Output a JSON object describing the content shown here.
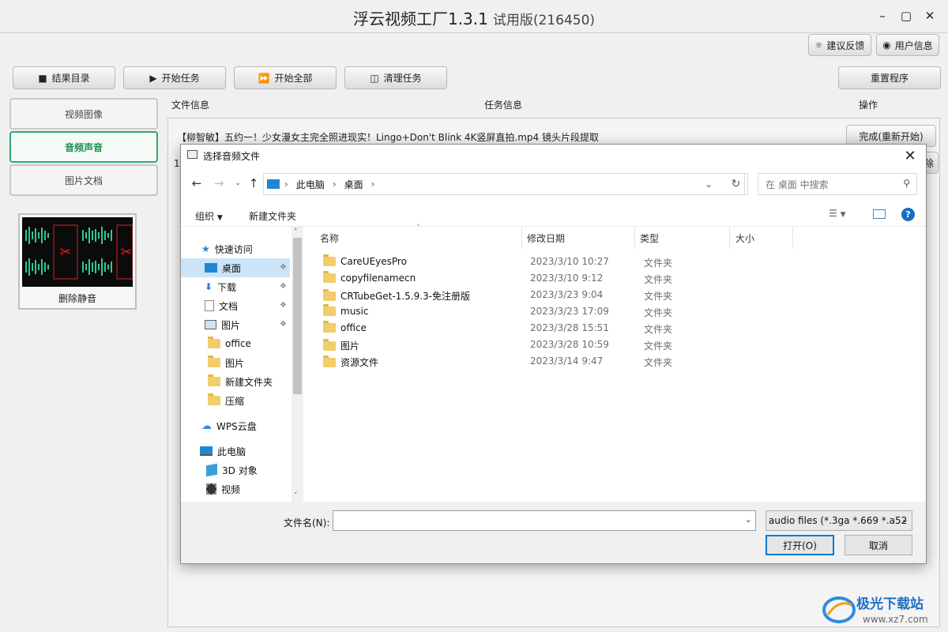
{
  "app": {
    "title": "浮云视频工厂1.3.1",
    "edition": "试用版(216450)",
    "feedback_label": "建议反馈",
    "userinfo_label": "用户信息"
  },
  "toolbar": {
    "result_dir": "结果目录",
    "start_task": "开始任务",
    "start_all": "开始全部",
    "clear_tasks": "清理任务",
    "reset_program": "重置程序"
  },
  "sidebar": {
    "items": [
      {
        "label": "视频图像"
      },
      {
        "label": "音频声音"
      },
      {
        "label": "图片文档"
      }
    ],
    "card_label": "删除静音"
  },
  "task_table": {
    "headers": [
      "文件信息",
      "任务信息",
      "操作"
    ],
    "row_filename": "【柳智敏】五约一！少女漫女主完全照进现实！Lingo+Don't Blink 4K竖屏直拍.mp4 镜头片段提取",
    "row_index": "1",
    "row_action": "完成(重新开始)",
    "row_action2": "除"
  },
  "dialog": {
    "title": "选择音频文件",
    "breadcrumb": [
      "此电脑",
      "桌面"
    ],
    "search_placeholder": "在 桌面 中搜索",
    "organize": "组织",
    "new_folder": "新建文件夹",
    "nav": [
      {
        "label": "快速访问",
        "icon": "star-icon"
      },
      {
        "label": "桌面",
        "icon": "desktop-icon",
        "pinned": true,
        "selected": true
      },
      {
        "label": "下载",
        "icon": "download-icon",
        "pinned": true
      },
      {
        "label": "文档",
        "icon": "document-icon",
        "pinned": true
      },
      {
        "label": "图片",
        "icon": "picture-icon",
        "pinned": true
      },
      {
        "label": "office",
        "icon": "folder-icon"
      },
      {
        "label": "图片",
        "icon": "folder-icon"
      },
      {
        "label": "新建文件夹",
        "icon": "folder-icon"
      },
      {
        "label": "压缩",
        "icon": "folder-icon"
      },
      {
        "label": "WPS云盘",
        "icon": "cloud-icon"
      },
      {
        "label": "此电脑",
        "icon": "computer-icon"
      },
      {
        "label": "3D 对象",
        "icon": "cube-icon"
      },
      {
        "label": "视频",
        "icon": "video-icon"
      }
    ],
    "columns": {
      "name": "名称",
      "date": "修改日期",
      "type": "类型",
      "size": "大小"
    },
    "files": [
      {
        "name": "CareUEyesPro",
        "date": "2023/3/10 10:27",
        "type": "文件夹"
      },
      {
        "name": "copyfilenamecn",
        "date": "2023/3/10 9:12",
        "type": "文件夹"
      },
      {
        "name": "CRTubeGet-1.5.9.3-免注册版",
        "date": "2023/3/23 9:04",
        "type": "文件夹"
      },
      {
        "name": "music",
        "date": "2023/3/23 17:09",
        "type": "文件夹"
      },
      {
        "name": "office",
        "date": "2023/3/28 15:51",
        "type": "文件夹"
      },
      {
        "name": "图片",
        "date": "2023/3/28 10:59",
        "type": "文件夹"
      },
      {
        "name": "资源文件",
        "date": "2023/3/14 9:47",
        "type": "文件夹"
      }
    ],
    "filename_label": "文件名(N):",
    "filename_value": "",
    "filetype_value": "audio files (*.3ga *.669 *.a52",
    "open_label": "打开(O)",
    "cancel_label": "取消"
  },
  "watermark": {
    "name": "极光下载站",
    "url": "www.xz7.com"
  },
  "colors": {
    "accent_green": "#2eaa6d",
    "selection_blue": "#cce4f7",
    "primary_blue": "#0078d7"
  }
}
